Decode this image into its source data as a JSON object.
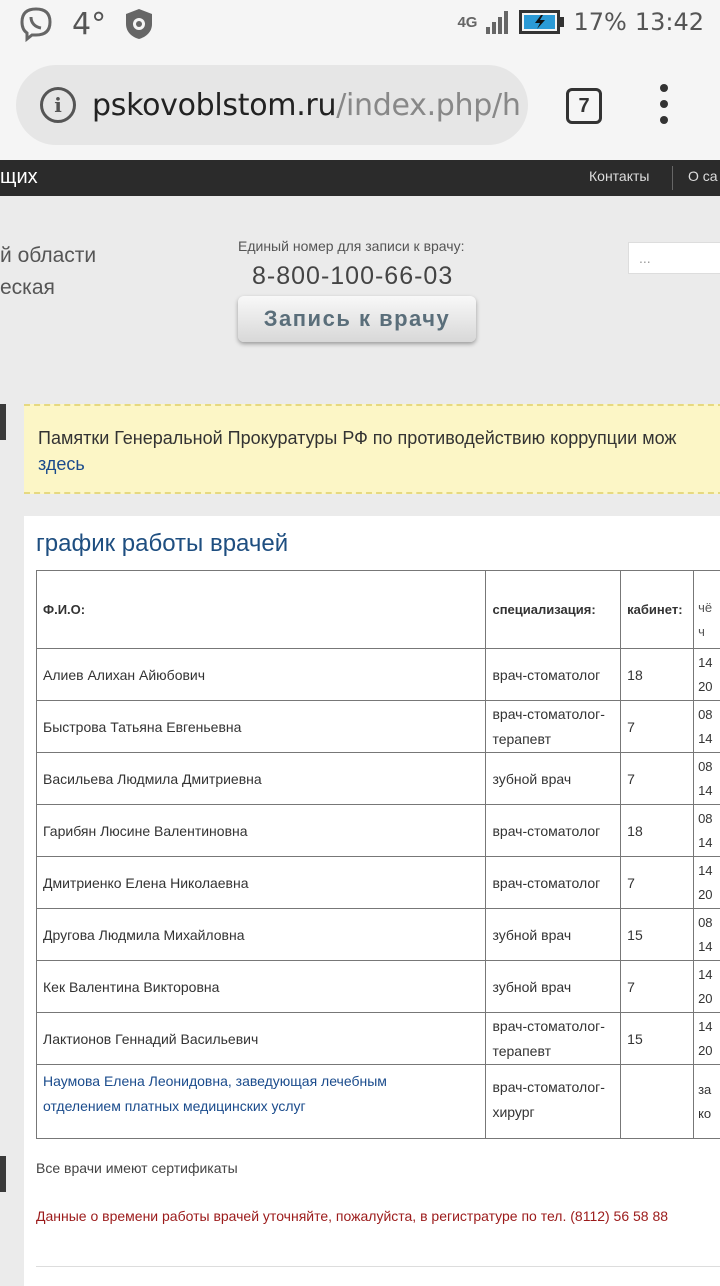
{
  "status_bar": {
    "temperature": "4°",
    "network": "4G",
    "battery": "17%",
    "time": "13:42",
    "icons": [
      "viber-icon",
      "bug-shield-icon",
      "signal-icon",
      "battery-charging-icon"
    ]
  },
  "browser": {
    "url_host": "pskovoblstom.ru",
    "url_path": "/index.php/h",
    "tab_count": "7"
  },
  "topnav": {
    "left_text": "щих",
    "items": [
      "Контакты",
      "О са"
    ]
  },
  "header": {
    "region_line1": "й области",
    "region_line2": "еская",
    "phone_caption": "Единый номер для записи к врачу:",
    "phone_number": "8-800-100-66-03",
    "appointment_button": "Запись к врачу",
    "search_placeholder": "..."
  },
  "notice": {
    "text": "Памятки Генеральной Прокуратуры РФ по противодействию коррупции мож",
    "link": "здесь"
  },
  "main": {
    "title": "график работы врачей",
    "table": {
      "headers": {
        "name": "Ф.И.О:",
        "spec": "специализация:",
        "room": "кабинет:",
        "time_top": "",
        "time_day": "чё",
        "time_day2": "ч"
      },
      "rows": [
        {
          "name": "Алиев Алихан Айюбович",
          "spec": "врач-стоматолог",
          "spec2": "",
          "room": "18",
          "t1": "14",
          "t2": "20"
        },
        {
          "name": "Быстрова Татьяна Евгеньевна",
          "spec": "врач-стоматолог-",
          "spec2": "терапевт",
          "room": "7",
          "t1": "08",
          "t2": "14"
        },
        {
          "name": "Васильева Людмила Дмитриевна",
          "spec": "зубной врач",
          "spec2": "",
          "room": "7",
          "t1": "08",
          "t2": "14"
        },
        {
          "name": "Гарибян Люсине Валентиновна",
          "spec": "врач-стоматолог",
          "spec2": "",
          "room": "18",
          "t1": "08",
          "t2": "14"
        },
        {
          "name": "Дмитриенко Елена Николаевна",
          "spec": "врач-стоматолог",
          "spec2": "",
          "room": "7",
          "t1": "14",
          "t2": "20"
        },
        {
          "name": "Другова Людмила Михайловна",
          "spec": "зубной врач",
          "spec2": "",
          "room": "15",
          "t1": "08",
          "t2": "14"
        },
        {
          "name": "Кек Валентина Викторовна",
          "spec": "зубной врач",
          "spec2": "",
          "room": " 7",
          "t1": " 14",
          "t2": "20"
        },
        {
          "name": "Лактионов Геннадий Васильевич",
          "spec": "врач-стоматолог-",
          "spec2": "терапевт",
          "room": " 15",
          "t1": " 14",
          "t2": "20"
        }
      ],
      "last_row": {
        "name_line1": "Наумова Елена Леонидовна, заведующая лечебным",
        "name_line2": "отделением платных медицинских услуг",
        "spec": "врач-стоматолог-",
        "spec2": "хирург",
        "room": "",
        "t1": "за",
        "t2": "ко"
      }
    },
    "note_certificates": "Все врачи имеют сертификаты",
    "note_schedule": "Данные о времени работы врачей уточняйте, пожалуйста, в регистратуре по тел. (8112) 56 58 88"
  }
}
